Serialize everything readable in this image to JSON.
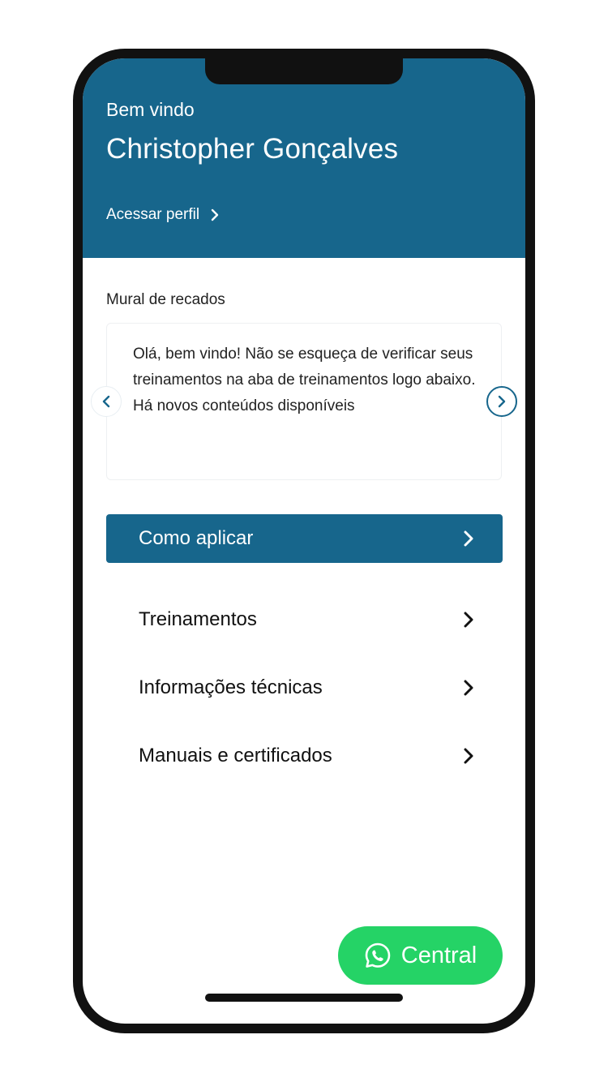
{
  "header": {
    "greeting": "Bem vindo",
    "user_name": "Christopher Gonçalves",
    "profile_link": "Acessar perfil"
  },
  "board": {
    "title": "Mural de recados",
    "message": "Olá, bem vindo! Não se esqueça de verificar seus treinamentos na aba de treinamentos logo abaixo. Há novos conteúdos disponíveis"
  },
  "primary_action": {
    "label": "Como aplicar"
  },
  "menu": {
    "items": [
      {
        "label": "Treinamentos"
      },
      {
        "label": "Informações técnicas"
      },
      {
        "label": "Manuais e certificados"
      }
    ]
  },
  "fab": {
    "label": "Central",
    "icon": "whatsapp-icon"
  },
  "colors": {
    "primary": "#17668c",
    "whatsapp": "#25d366",
    "text": "#111111"
  }
}
